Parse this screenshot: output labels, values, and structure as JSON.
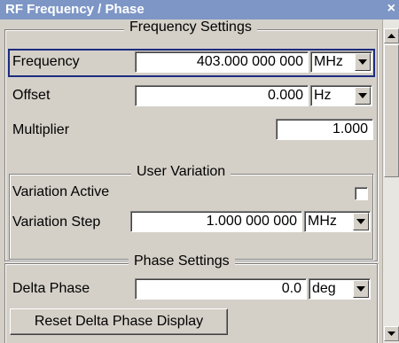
{
  "window": {
    "title": "RF Frequency / Phase",
    "close_glyph": "×"
  },
  "frequency_settings": {
    "title": "Frequency Settings",
    "frequency": {
      "label": "Frequency",
      "value": "403.000 000 000",
      "unit": "MHz"
    },
    "offset": {
      "label": "Offset",
      "value": "0.000",
      "unit": "Hz"
    },
    "multiplier": {
      "label": "Multiplier",
      "value": "1.000"
    }
  },
  "user_variation": {
    "title": "User Variation",
    "variation_active": {
      "label": "Variation Active",
      "checked": false
    },
    "variation_step": {
      "label": "Variation Step",
      "value": "1.000 000 000",
      "unit": "MHz"
    }
  },
  "phase_settings": {
    "title": "Phase Settings",
    "delta_phase": {
      "label": "Delta Phase",
      "value": "0.0",
      "unit": "deg"
    },
    "reset_button": "Reset Delta Phase Display"
  },
  "icons": {
    "dropdown": "chevron-down-icon",
    "scroll_up": "arrow-up-icon",
    "scroll_down": "arrow-down-icon",
    "close": "close-icon"
  }
}
